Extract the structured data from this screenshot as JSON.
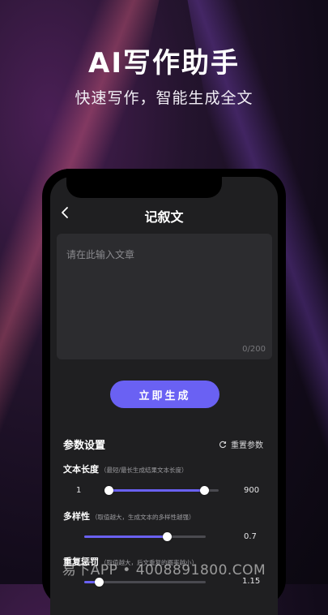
{
  "promo": {
    "headline": "AI写作助手",
    "subline": "快速写作，智能生成全文"
  },
  "nav": {
    "title": "记叙文",
    "back_icon": "chevron-left-icon"
  },
  "editor": {
    "placeholder": "请在此输入文章",
    "counter": "0/200"
  },
  "actions": {
    "generate_label": "立即生成"
  },
  "params": {
    "section_title": "参数设置",
    "reset_label": "重置参数",
    "reset_icon": "refresh-icon",
    "text_length": {
      "label": "文本长度",
      "hint": "（最短/最长生成结果文本长度）",
      "min_value": "1",
      "max_value": "900",
      "range_fraction": [
        0.0,
        0.87
      ]
    },
    "diversity": {
      "label": "多样性",
      "hint": "（取值越大，生成文本的多样性越强）",
      "value": "0.7",
      "fraction": 0.68
    },
    "repetition_penalty": {
      "label": "重复惩罚",
      "hint": "（取值越大，后文重复的概率越小）",
      "value": "1.15",
      "fraction": 0.12
    }
  },
  "watermark": "易下APP • 4008891800.COM",
  "colors": {
    "accent": "#6a61f3",
    "background": "#1f1f21"
  }
}
